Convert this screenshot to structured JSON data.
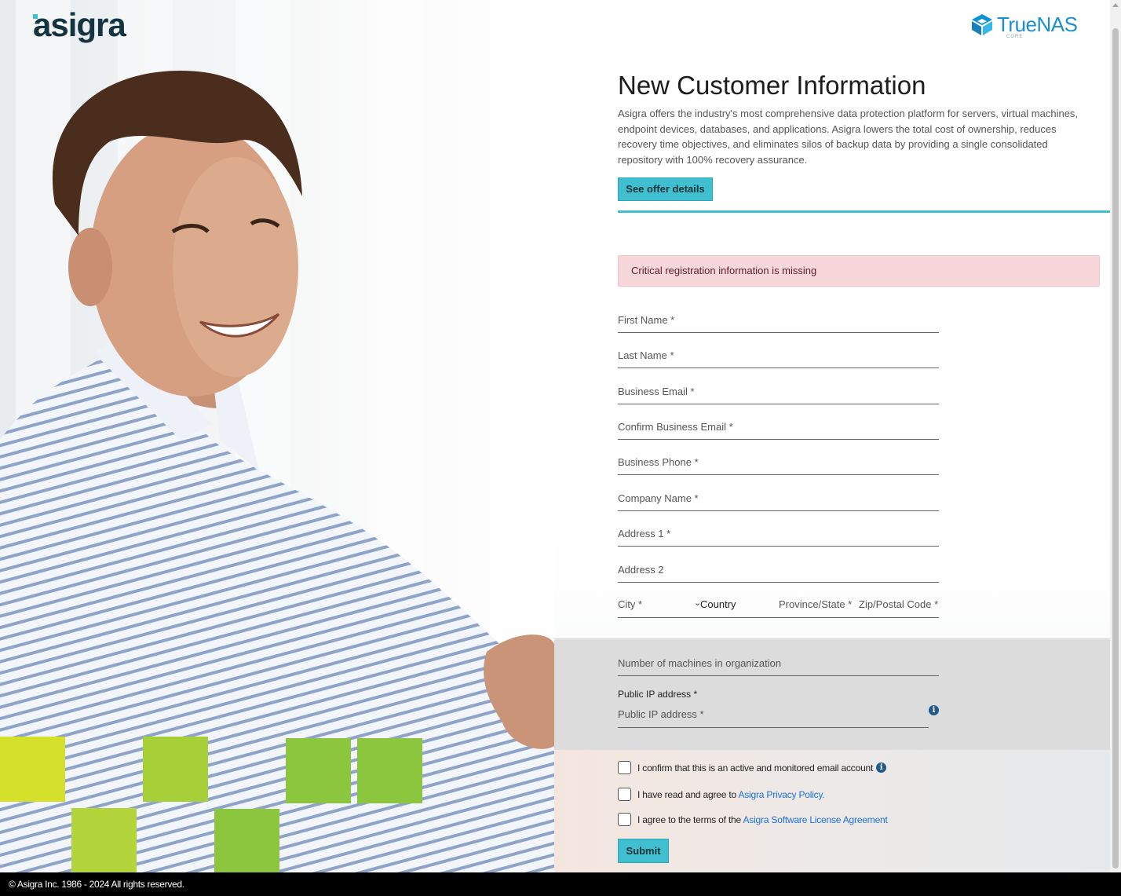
{
  "brand": {
    "logo_text": "asigra",
    "partner_logo_text": "TrueNAS",
    "partner_logo_sub": "CORE"
  },
  "page": {
    "title": "New Customer Information",
    "intro": "Asigra offers the industry's most comprehensive data protection platform for servers, virtual machines, endpoint devices, databases, and applications. Asigra lowers the total cost of ownership, reduces recovery time objectives, and eliminates silos of backup data by providing a single consolidated repository with 100% recovery assurance.",
    "offer_button": "See offer details"
  },
  "alert": {
    "message": "Critical registration information is missing"
  },
  "form": {
    "first_name": "First Name *",
    "last_name": "Last Name *",
    "business_email": "Business Email *",
    "confirm_email": "Confirm Business Email *",
    "business_phone": "Business Phone *",
    "company_name": "Company Name *",
    "address1": "Address 1 *",
    "address2": "Address 2",
    "city": "City *",
    "country": "Country",
    "province": "Province/State *",
    "zip": "Zip/Postal Code *",
    "machines": "Number of machines in organization",
    "public_ip_label": "Public IP address *",
    "public_ip_placeholder": "Public IP address *"
  },
  "checkboxes": {
    "confirm_email_text": "I confirm that this is an active and monitored email account",
    "privacy_prefix": "I have read and agree to ",
    "privacy_link": "Asigra Privacy Policy",
    "privacy_suffix": ".",
    "license_prefix": "I agree to the terms of the ",
    "license_link": "Asigra Software License Agreement"
  },
  "submit_button": "Submit",
  "footer": {
    "copyright": "© Asigra Inc. 1986 - 2024 All rights reserved."
  },
  "colors": {
    "accent": "#3fbfd0",
    "alert_bg": "#f8d7da",
    "link": "#1a6fd8",
    "square_green": "#8cc63f",
    "square_lime": "#d4e02a"
  },
  "icons": {
    "info": "info-circle-icon",
    "dropdown": "chevron-down-icon",
    "partner_mark": "truenas-cube-icon"
  }
}
